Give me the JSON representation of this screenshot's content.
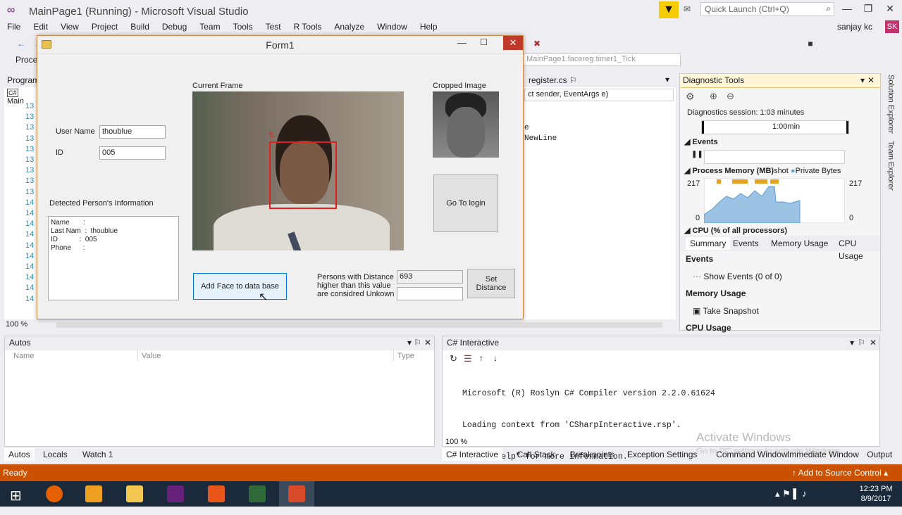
{
  "window": {
    "title": "MainPage1 (Running) - Microsoft Visual Studio",
    "quick_launch_placeholder": "Quick Launch (Ctrl+Q)",
    "user": "sanjay kc",
    "user_initials": "SK"
  },
  "menu": [
    "File",
    "Edit",
    "View",
    "Project",
    "Build",
    "Debug",
    "Team",
    "Tools",
    "Test",
    "R Tools",
    "Analyze",
    "Window",
    "Help"
  ],
  "toolbar": {
    "process_label": "Proce",
    "stack_frame": "MainPage1.facereg.timer1_Tick"
  },
  "left_panel": {
    "title": "Program",
    "tree_item": "Main",
    "line_numbers": [
      "13",
      "13",
      "13",
      "13",
      "13",
      "13",
      "13",
      "13",
      "13",
      "14",
      "14",
      "14",
      "14",
      "14",
      "14",
      "14",
      "14",
      "14",
      "14"
    ],
    "zoom": "100 %"
  },
  "form": {
    "title": "Form1",
    "current_frame_label": "Current Frame",
    "cropped_image_label": "Cropped Image",
    "user_name_label": "User Name",
    "user_name_value": "thoublue",
    "id_label": "ID",
    "id_value": "005",
    "detected_label": "Detected Person's Information",
    "info_lines": [
      "Name       :",
      "Last Nam  :  thoublue",
      "ID           :  005",
      "Phone      :"
    ],
    "face_tag": "5:",
    "go_login": "Go To login",
    "add_face": "Add Face to data base",
    "distance_desc_1": "Persons with Distance",
    "distance_desc_2": "higher than this value",
    "distance_desc_3": "are considred Unkown",
    "distance_value": "693",
    "set_distance_1": "Set",
    "set_distance_2": "Distance"
  },
  "editor": {
    "tab": "register.cs",
    "method_combo": "ct sender, EventArgs e)",
    "code_line_1": "e",
    "code_line_2": "NewLine"
  },
  "diagnostics": {
    "title": "Diagnostic Tools",
    "session": "Diagnostics session: 1:03 minutes",
    "timeline_mark": "1:00min",
    "events_section": "Events",
    "memory_section": "Process Memory (MB)",
    "snapshot_legend": "shot",
    "private_bytes_legend": "Private Bytes",
    "mem_max_left": "217",
    "mem_min_left": "0",
    "mem_max_right": "217",
    "mem_min_right": "0",
    "cpu_section": "CPU (% of all processors)",
    "tabs": [
      "Summary",
      "Events",
      "Memory Usage",
      "CPU Usage"
    ],
    "summary_events": "Events",
    "show_events": "Show Events (0 of 0)",
    "memory_usage": "Memory Usage",
    "take_snapshot": "Take Snapshot",
    "cpu_usage": "CPU Usage"
  },
  "side_tabs": [
    "Solution Explorer",
    "Team Explorer"
  ],
  "autos": {
    "title": "Autos",
    "columns": [
      "Name",
      "Value",
      "Type"
    ],
    "tabs": [
      "Autos",
      "Locals",
      "Watch 1"
    ]
  },
  "interactive": {
    "title": "C# Interactive",
    "lines": [
      "Microsoft (R) Roslyn C# Compiler version 2.2.0.61624",
      "Loading context from 'CSharpInteractive.rsp'.",
      "Type \"#help\" for more information.",
      ">"
    ],
    "zoom": "100 %",
    "watermark_1": "Activate Windows",
    "watermark_2": "Go to PC settings to activate Windows.",
    "tabs": [
      "C# Interactive",
      "Call Stack",
      "Breakpoints",
      "Exception Settings",
      "Command Window",
      "Immediate Window",
      "Output"
    ]
  },
  "status": {
    "ready": "Ready",
    "source_control": "Add to Source Control"
  },
  "taskbar": {
    "time": "12:23 PM",
    "date": "8/9/2017"
  },
  "colors": {
    "status_bar": "#ca5100",
    "accent": "#68217a",
    "face_box": "#e02020"
  }
}
